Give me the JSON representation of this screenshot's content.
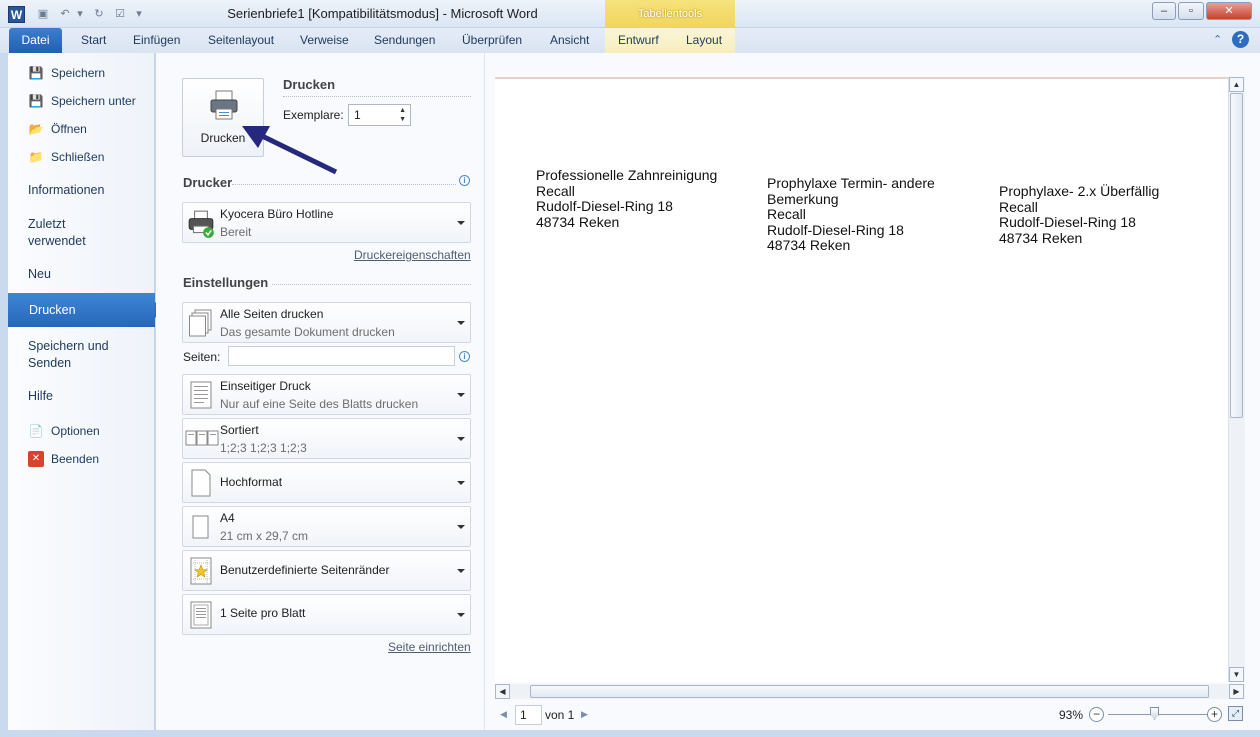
{
  "window": {
    "title": "Serienbriefe1 [Kompatibilitätsmodus]  -  Microsoft Word",
    "contextual_tab_group": "Tabellentools"
  },
  "ribbon": {
    "file_tab": "Datei",
    "tabs": [
      "Start",
      "Einfügen",
      "Seitenlayout",
      "Verweise",
      "Sendungen",
      "Überprüfen",
      "Ansicht"
    ],
    "contextual_tabs": [
      "Entwurf",
      "Layout"
    ]
  },
  "backstage_nav": {
    "items": [
      {
        "label": "Speichern",
        "icon": "save-icon"
      },
      {
        "label": "Speichern unter",
        "icon": "save-as-icon"
      },
      {
        "label": "Öffnen",
        "icon": "open-folder-icon"
      },
      {
        "label": "Schließen",
        "icon": "close-folder-icon"
      }
    ],
    "informationen": "Informationen",
    "zuletzt": "Zuletzt verwendet",
    "neu": "Neu",
    "drucken": "Drucken",
    "speichern_senden": "Speichern und Senden",
    "hilfe": "Hilfe",
    "optionen": "Optionen",
    "beenden": "Beenden"
  },
  "print": {
    "heading": "Drucken",
    "button_label": "Drucken",
    "copies_label": "Exemplare:",
    "copies_value": "1"
  },
  "printer": {
    "heading": "Drucker",
    "name": "Kyocera Büro Hotline",
    "status": "Bereit",
    "properties_link": "Druckereigenschaften"
  },
  "settings": {
    "heading": "Einstellungen",
    "pages_label": "Seiten:",
    "pages_value": "",
    "page_setup_link": "Seite einrichten",
    "options": [
      {
        "title": "Alle Seiten drucken",
        "subtitle": "Das gesamte Dokument drucken",
        "icon": "pages-icon"
      },
      {
        "title": "Einseitiger Druck",
        "subtitle": "Nur auf eine Seite des Blatts drucken",
        "icon": "one-sided-icon"
      },
      {
        "title": "Sortiert",
        "subtitle": "1;2;3    1;2;3    1;2;3",
        "icon": "collated-icon"
      },
      {
        "title": "Hochformat",
        "subtitle": "",
        "icon": "portrait-icon"
      },
      {
        "title": "A4",
        "subtitle": "21   cm x 29,7   cm",
        "icon": "paper-size-icon"
      },
      {
        "title": "Benutzerdefinierte Seitenränder",
        "subtitle": "",
        "icon": "margins-icon"
      },
      {
        "title": "1 Seite pro Blatt",
        "subtitle": "",
        "icon": "pages-per-sheet-icon"
      }
    ]
  },
  "preview": {
    "labels": [
      [
        "Professionelle Zahnreinigung",
        "Recall",
        "Rudolf-Diesel-Ring 18",
        "48734 Reken"
      ],
      [
        "Prophylaxe Termin- andere",
        "Bemerkung",
        "Recall",
        "Rudolf-Diesel-Ring 18",
        "48734 Reken"
      ],
      [
        "Prophylaxe- 2.x Überfällig",
        "Recall",
        "Rudolf-Diesel-Ring 18",
        "48734 Reken"
      ]
    ]
  },
  "status": {
    "current_page": "1",
    "page_of": "von 1",
    "zoom": "93%",
    "zoom_value": 93
  }
}
